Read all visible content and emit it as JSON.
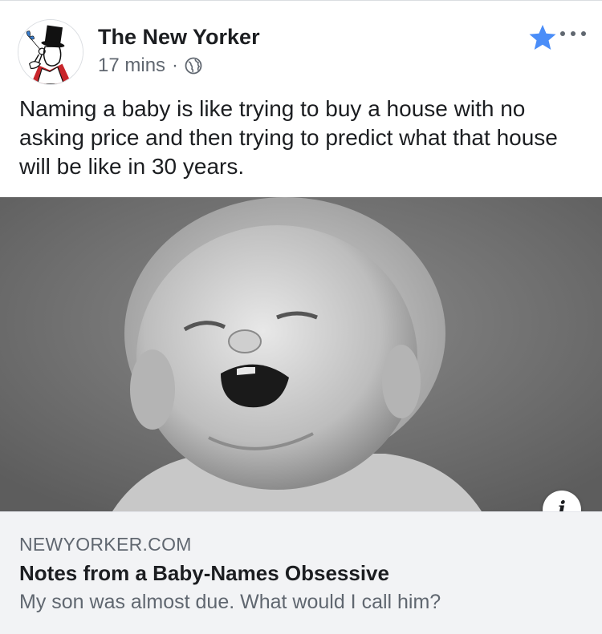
{
  "post": {
    "page_name": "The New Yorker",
    "timestamp": "17 mins",
    "separator": "·",
    "privacy_icon": "globe-icon",
    "text": "Naming a baby is like trying to buy a house with no asking price and then trying to predict what that house will be like in 30 years.",
    "actions": {
      "favorite_icon": "star-icon",
      "favorite_color": "#4a8df8",
      "more_icon": "more-options-icon"
    }
  },
  "link_preview": {
    "image_icon": "crying-baby-photo",
    "info_label": "i",
    "domain": "NEWYORKER.COM",
    "title": "Notes from a Baby-Names Obsessive",
    "description": "My son was almost due. What would I call him?"
  },
  "colors": {
    "text_primary": "#1c1e21",
    "text_secondary": "#606770",
    "link_bg": "#f2f3f5",
    "accent_blue": "#4a8df8"
  }
}
